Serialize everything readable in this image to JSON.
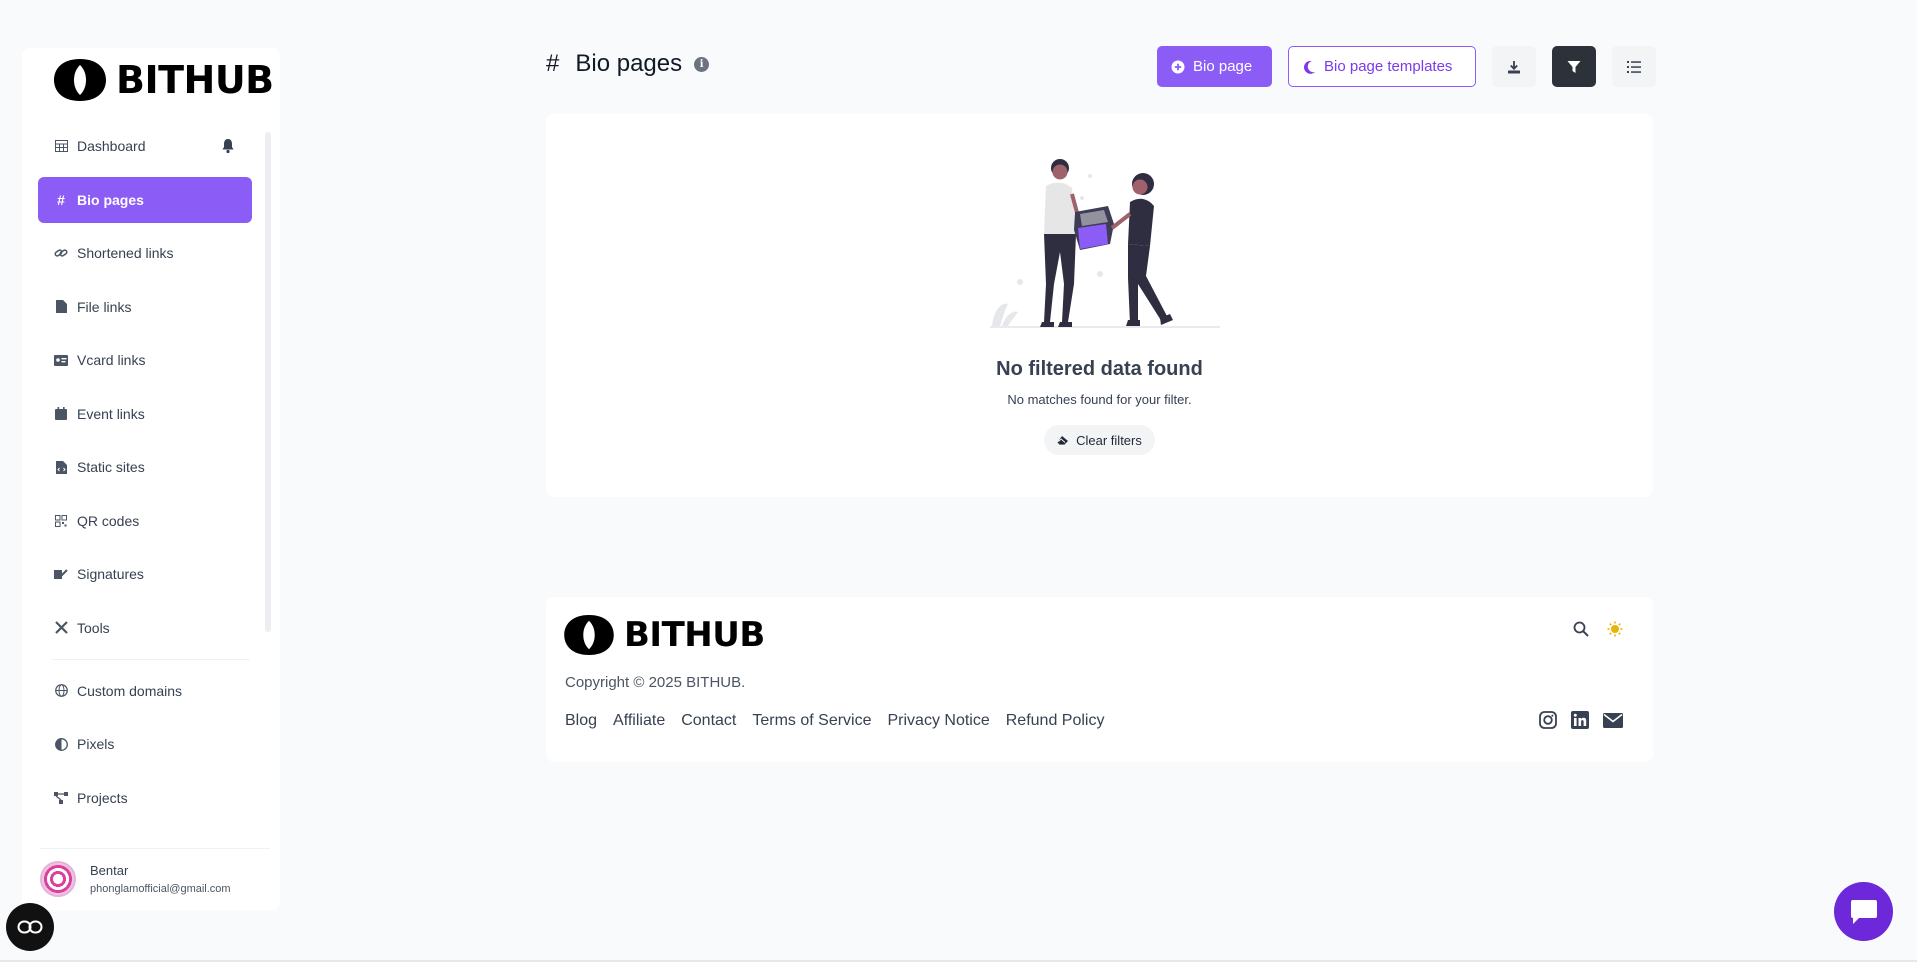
{
  "brand": {
    "name": "BITHUB"
  },
  "sidebar": {
    "items": [
      {
        "label": "Dashboard",
        "icon": "table-icon"
      },
      {
        "label": "Bio pages",
        "icon": "hash-icon",
        "active": true
      },
      {
        "label": "Shortened links",
        "icon": "link-icon"
      },
      {
        "label": "File links",
        "icon": "file-icon"
      },
      {
        "label": "Vcard links",
        "icon": "id-card-icon"
      },
      {
        "label": "Event links",
        "icon": "calendar-icon"
      },
      {
        "label": "Static sites",
        "icon": "file-code-icon"
      },
      {
        "label": "QR codes",
        "icon": "qrcode-icon"
      },
      {
        "label": "Signatures",
        "icon": "signature-icon"
      },
      {
        "label": "Tools",
        "icon": "tools-icon"
      },
      {
        "label": "Custom domains",
        "icon": "globe-icon"
      },
      {
        "label": "Pixels",
        "icon": "adjust-icon"
      },
      {
        "label": "Projects",
        "icon": "project-diagram-icon"
      }
    ],
    "user": {
      "name": "Bentar",
      "email": "phonglamofficial@gmail.com"
    }
  },
  "header": {
    "hash": "#",
    "title": "Bio pages",
    "create_label": "Bio page",
    "templates_label": "Bio page templates"
  },
  "empty": {
    "title": "No filtered data found",
    "subtitle": "No matches found for your filter.",
    "clear_label": "Clear filters"
  },
  "footer": {
    "copyright": "Copyright © 2025 BITHUB.",
    "links": [
      "Blog",
      "Affiliate",
      "Contact",
      "Terms of Service",
      "Privacy Notice",
      "Refund Policy"
    ]
  },
  "colors": {
    "accent": "#8b5cf6",
    "dark": "#2d3139",
    "sun": "#eab308"
  }
}
